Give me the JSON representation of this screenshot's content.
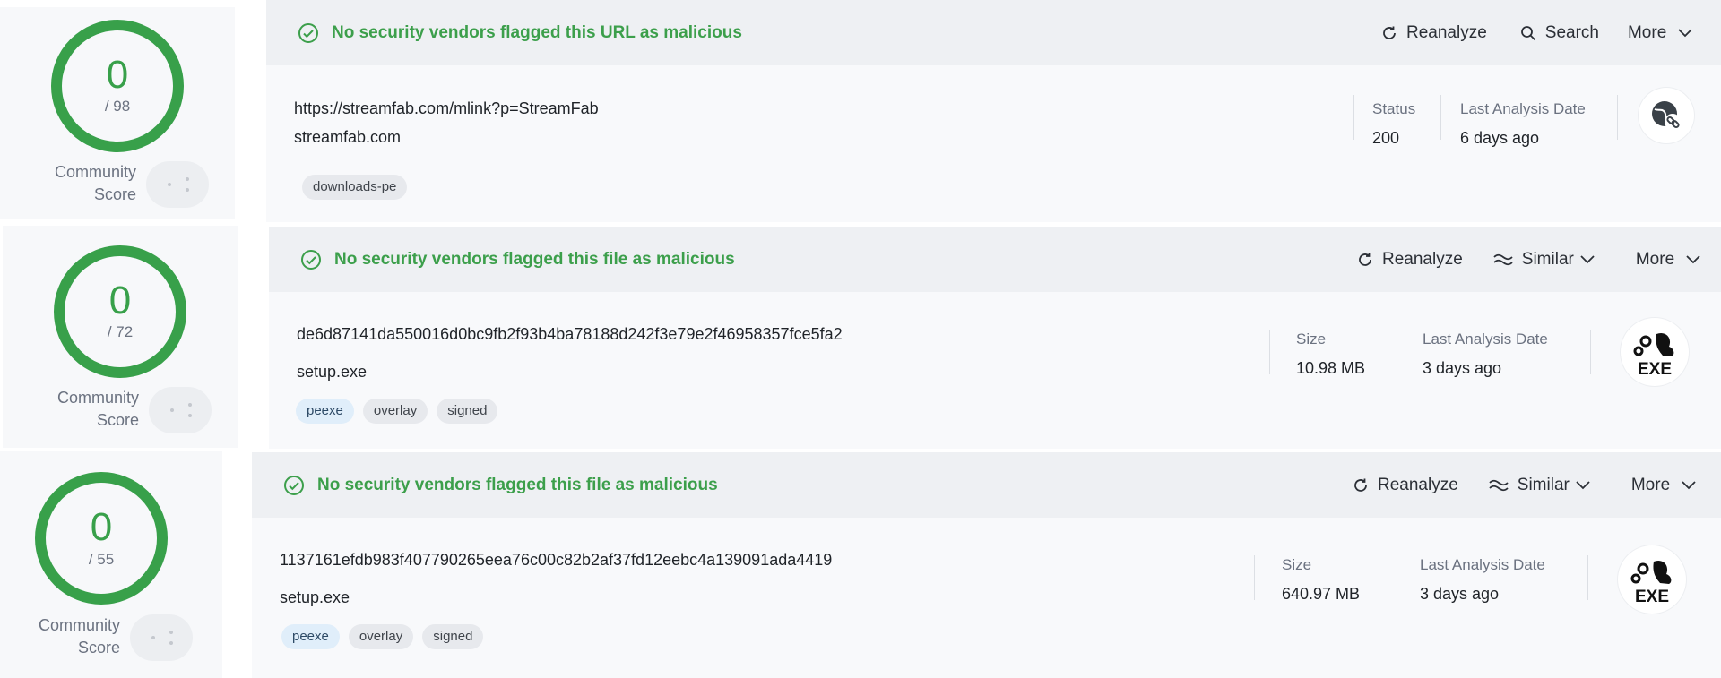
{
  "results": [
    {
      "score": {
        "detections": "0",
        "total": "/ 98",
        "community_label_1": "Community",
        "community_label_2": "Score"
      },
      "verdict": "No security vendors flagged this URL as malicious",
      "actions": {
        "reanalyze": "Reanalyze",
        "search": "Search",
        "more": "More"
      },
      "url": "https://streamfab.com/mlink?p=StreamFab",
      "domain": "streamfab.com",
      "tags": [
        "downloads-pe"
      ],
      "meta": [
        {
          "label": "Status",
          "value": "200"
        },
        {
          "label": "Last Analysis Date",
          "value": "6 days ago"
        }
      ],
      "icon": "globe-link-icon"
    },
    {
      "score": {
        "detections": "0",
        "total": "/ 72",
        "community_label_1": "Community",
        "community_label_2": "Score"
      },
      "verdict": "No security vendors flagged this file as malicious",
      "actions": {
        "reanalyze": "Reanalyze",
        "similar": "Similar",
        "more": "More"
      },
      "hash": "de6d87141da550016d0bc9fb2f93b4ba78188d242f3e79e2f46958357fce5fa2",
      "filename": "setup.exe",
      "tags": [
        "peexe",
        "overlay",
        "signed"
      ],
      "meta": [
        {
          "label": "Size",
          "value": "10.98 MB"
        },
        {
          "label": "Last Analysis Date",
          "value": "3 days ago"
        }
      ],
      "icon": "exe-file-icon",
      "icon_text": "EXE"
    },
    {
      "score": {
        "detections": "0",
        "total": "/ 55",
        "community_label_1": "Community",
        "community_label_2": "Score"
      },
      "verdict": "No security vendors flagged this file as malicious",
      "actions": {
        "reanalyze": "Reanalyze",
        "similar": "Similar",
        "more": "More"
      },
      "hash": "1137161efdb983f407790265eea76c00c82b2af37fd12eebc4a139091ada4419",
      "filename": "setup.exe",
      "tags": [
        "peexe",
        "overlay",
        "signed"
      ],
      "meta": [
        {
          "label": "Size",
          "value": "640.97 MB"
        },
        {
          "label": "Last Analysis Date",
          "value": "3 days ago"
        }
      ],
      "icon": "exe-file-icon",
      "icon_text": "EXE"
    }
  ],
  "colors": {
    "clean_green": "#38a04a",
    "header_bg": "#eef0f3",
    "tag_blue": "#e0eefa"
  }
}
